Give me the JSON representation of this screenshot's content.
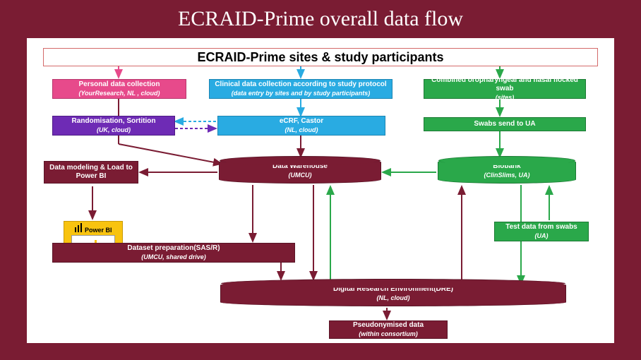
{
  "title": "ECRAID-Prime overall data flow",
  "sites": "ECRAID-Prime sites & study participants",
  "nodes": {
    "personal": {
      "l": "Personal data collection",
      "s": "(YourResearch, NL , cloud)"
    },
    "clinical": {
      "l": "Clinical data collection according to study protocol",
      "s": "(data entry by sites and by study participants)"
    },
    "swab": {
      "l": "Combined oropharyngeal and nasal flocked swab",
      "s": "(sites)"
    },
    "rand": {
      "l": "Randomisation, Sortition",
      "s": "(UK, cloud)"
    },
    "ecrf": {
      "l": "eCRF, Castor",
      "s": "(NL, cloud)"
    },
    "swabs_ua": {
      "l": "Swabs send to UA",
      "s": ""
    },
    "modeling": {
      "l": "Data modeling & Load to Power BI",
      "s": ""
    },
    "warehouse": {
      "l": "Data Warehouse",
      "s": "(UMCU)"
    },
    "biobank": {
      "l": "Biobank",
      "s": "(ClinSlims, UA)"
    },
    "testdata": {
      "l": "Test data from swabs",
      "s": "(UA)"
    },
    "dataset": {
      "l": "Dataset preparation(SAS/R)",
      "s": "(UMCU, shared drive)"
    },
    "dre": {
      "l": "Digital Research Environment(DRE)",
      "s": "(NL, cloud)"
    },
    "pseudo": {
      "l": "Pseudonymised data",
      "s": "(within consortium)"
    },
    "powerbi": {
      "l": "Power BI"
    }
  }
}
